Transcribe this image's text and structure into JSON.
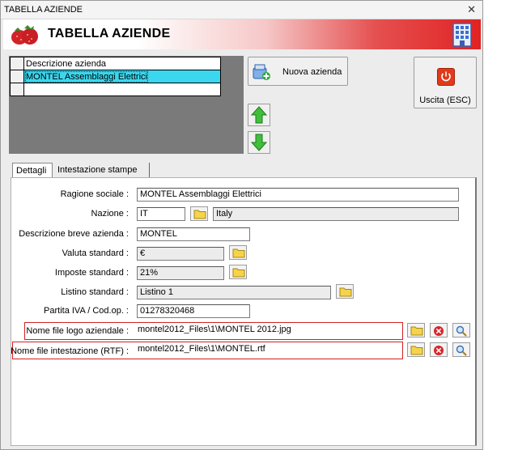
{
  "window": {
    "title": "TABELLA AZIENDE",
    "close_glyph": "✕"
  },
  "banner": {
    "title": "TABELLA AZIENDE",
    "left_icon": "strawberry-icon",
    "right_icon": "building-icon",
    "colors": {
      "gradient_end": "#e12222"
    }
  },
  "grid": {
    "header": "Descrizione azienda",
    "rows": [
      "MONTEL Assemblaggi Elettrici",
      ""
    ],
    "selected_color": "#3ad7ef"
  },
  "toolbar": {
    "new_label": "Nuova azienda",
    "exit_label": "Uscita (ESC)",
    "up_icon": "arrow-up-icon",
    "down_icon": "arrow-down-icon"
  },
  "tabs": [
    "Dettagli",
    "Intestazione stampe"
  ],
  "form": {
    "ragione_sociale": {
      "label": "Ragione sociale :",
      "value": "MONTEL Assemblaggi Elettrici"
    },
    "nazione": {
      "label": "Nazione :",
      "code": "IT",
      "name": "Italy"
    },
    "descrizione_breve": {
      "label": "Descrizione breve azienda :",
      "value": "MONTEL"
    },
    "valuta": {
      "label": "Valuta standard :",
      "value": "€"
    },
    "imposte": {
      "label": "Imposte standard :",
      "value": "21%"
    },
    "listino": {
      "label": "Listino standard :",
      "value": "Listino 1"
    },
    "partita_iva": {
      "label": "Partita IVA / Cod.op. :",
      "value": "01278320468"
    },
    "logo_file": {
      "label": "Nome file logo aziendale :",
      "value": "montel2012_Files\\1\\MONTEL 2012.jpg"
    },
    "rtf_file": {
      "label": "Nome file intestazione (RTF) :",
      "value": "montel2012_Files\\1\\MONTEL.rtf"
    }
  },
  "colors": {
    "highlight_border": "#d42020"
  }
}
